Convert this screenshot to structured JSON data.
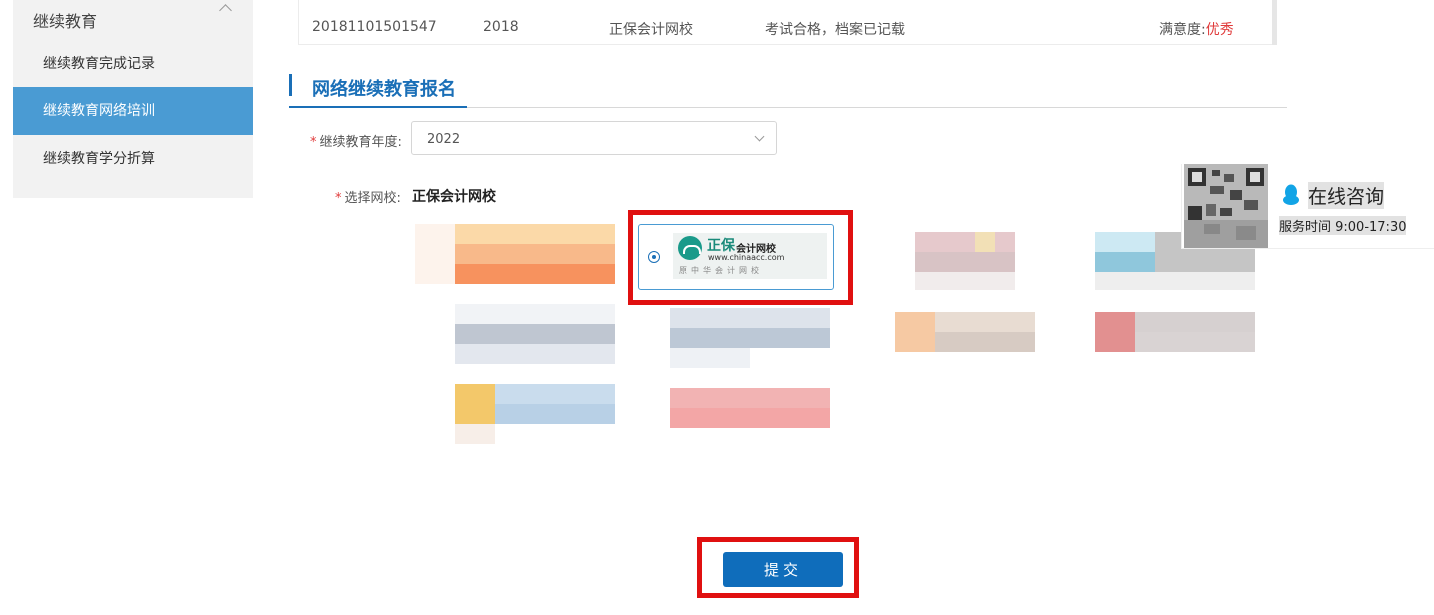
{
  "sidebar": {
    "header": "继续教育",
    "items": [
      {
        "label": "继续教育完成记录"
      },
      {
        "label": "继续教育网络培训",
        "active": true
      },
      {
        "label": "继续教育学分折算"
      }
    ]
  },
  "record": {
    "id": "20181101501547",
    "year": "2018",
    "school": "正保会计网校",
    "status": "考试合格，档案已记载",
    "satisfaction_label": "满意度:",
    "satisfaction_value": "优秀"
  },
  "section": {
    "title": "网络继续教育报名"
  },
  "form": {
    "year_label": "继续教育年度:",
    "year_value": "2022",
    "school_label": "选择网校:",
    "school_selected": "正保会计网校",
    "required_mark": "*"
  },
  "selected_logo": {
    "name_big": "正保",
    "name_small": "会计网校",
    "url": "www.chinaacc.com",
    "subtitle": "原中华会计网校"
  },
  "consult": {
    "title": "在线咨询",
    "hours": "服务时间 9:00-17:30"
  },
  "submit": {
    "label": "提交"
  },
  "colors": {
    "accent": "#1a6fb7",
    "sidebar_active": "#4a9bd3",
    "highlight_box": "#e01010",
    "rating_red": "#e03a3a"
  }
}
